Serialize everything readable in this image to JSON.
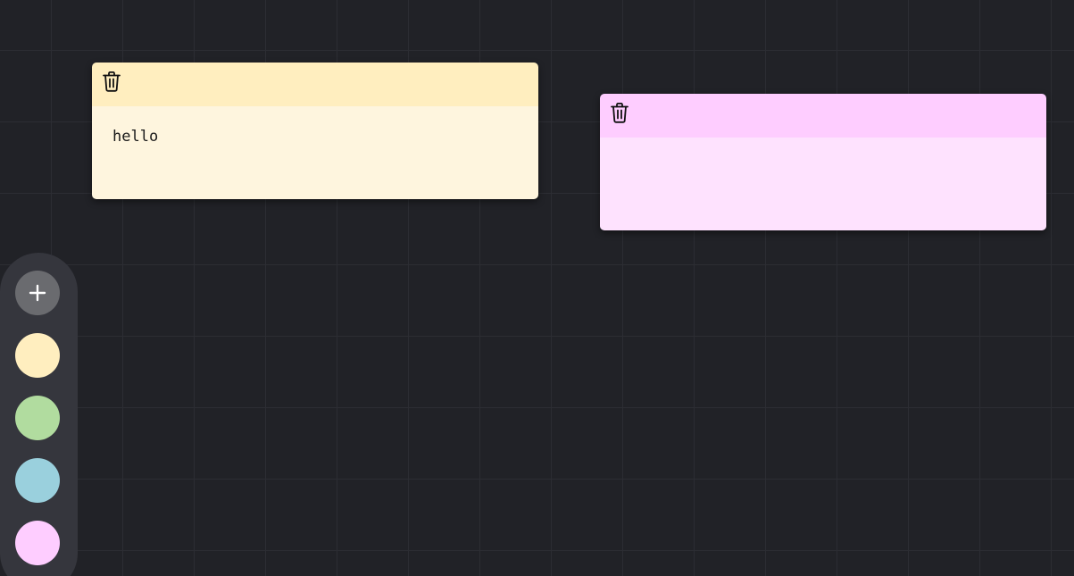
{
  "notes": [
    {
      "text": "hello",
      "header_color": "#ffeebf",
      "body_color": "#fef5de",
      "delete_icon": "trash-icon"
    },
    {
      "text": "",
      "header_color": "#fecdff",
      "body_color": "#fee2fe",
      "delete_icon": "trash-icon"
    }
  ],
  "palette": {
    "add_icon": "plus-icon",
    "add_button_color": "#6a6b6f",
    "colors": [
      "#ffeebf",
      "#b1dc9f",
      "#9ad0dd",
      "#fecdff"
    ]
  }
}
